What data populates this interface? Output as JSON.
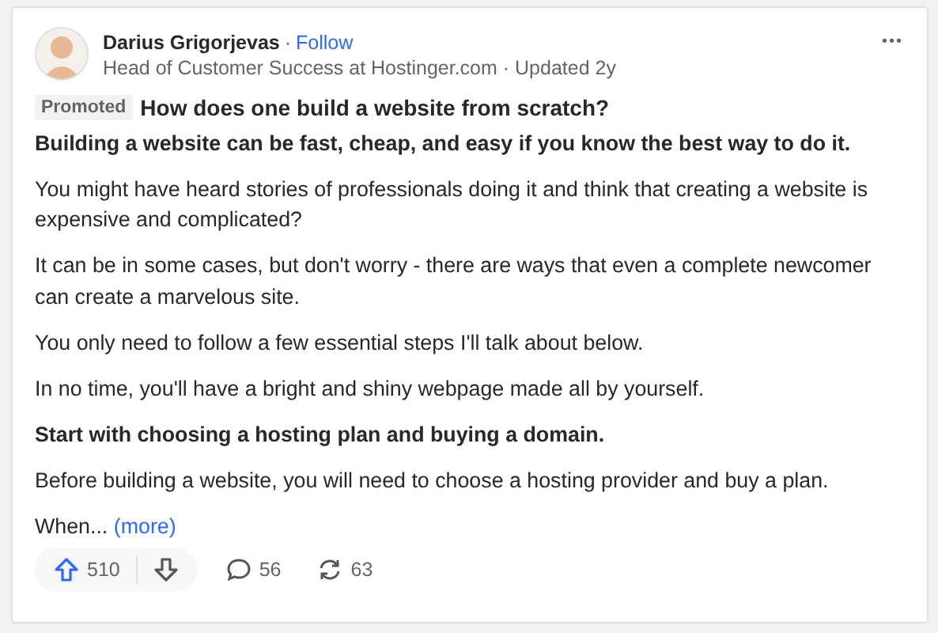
{
  "author": {
    "name": "Darius Grigorjevas",
    "follow": "Follow",
    "separator": "·",
    "credential": "Head of Customer Success at Hostinger.com · Updated 2y"
  },
  "more_menu": "•••",
  "badge": "Promoted",
  "question": "How does one build a website from scratch?",
  "paragraphs": [
    {
      "kind": "bold",
      "text": "Building a website can be fast, cheap, and easy if you know the best way to do it."
    },
    {
      "kind": "normal",
      "text": "You might have heard stories of professionals doing it and think that creating a website is expensive and complicated?"
    },
    {
      "kind": "normal",
      "text": "It can be in some cases, but don't worry - there are ways that even a complete newcomer can create a marvelous site."
    },
    {
      "kind": "normal",
      "text": "You only need to follow a few essential steps I'll talk about below."
    },
    {
      "kind": "normal",
      "text": "In no time, you'll have a bright and shiny webpage made all by yourself."
    },
    {
      "kind": "bold",
      "text": "Start with choosing a hosting plan and buying a domain."
    },
    {
      "kind": "normal",
      "text": "Before building a website, you will need to choose a hosting provider and buy a plan."
    }
  ],
  "truncated": {
    "text": "When...",
    "link": "(more)"
  },
  "actions": {
    "upvotes": "510",
    "comments": "56",
    "shares": "63"
  }
}
